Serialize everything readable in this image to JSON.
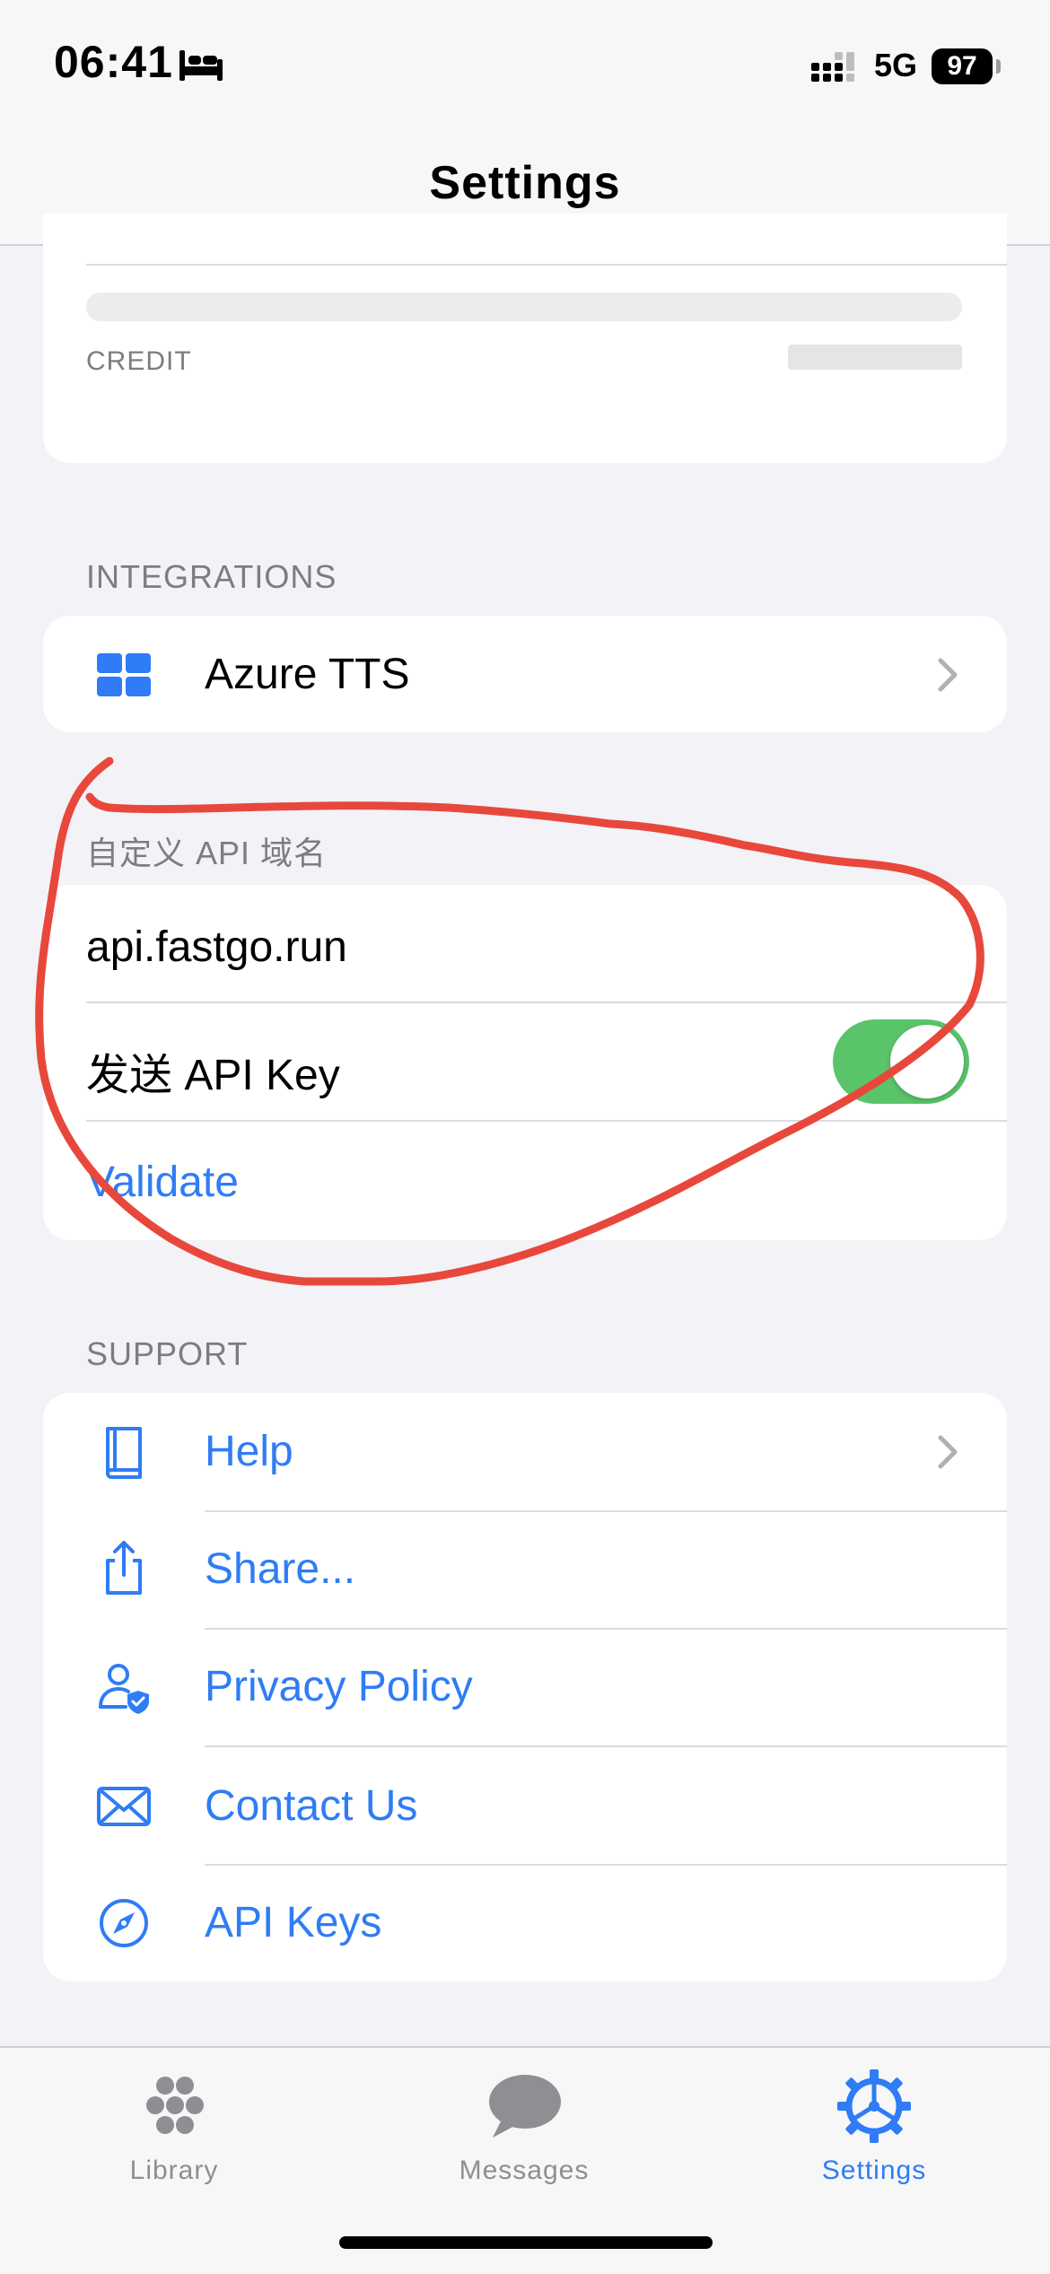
{
  "status_bar": {
    "time": "06:41",
    "network": "5G",
    "battery": "97"
  },
  "nav": {
    "title": "Settings"
  },
  "account": {
    "credit_label": "CREDIT"
  },
  "integrations": {
    "header": "INTEGRATIONS",
    "azure_label": "Azure TTS"
  },
  "custom_api": {
    "header": "自定义 API 域名",
    "domain_value": "api.fastgo.run",
    "send_key_label": "发送 API Key",
    "send_key_enabled": true,
    "validate_label": "Validate"
  },
  "support": {
    "header": "SUPPORT",
    "items": [
      {
        "label": "Help",
        "icon": "book-icon"
      },
      {
        "label": "Share...",
        "icon": "share-icon"
      },
      {
        "label": "Privacy Policy",
        "icon": "privacy-shield-person-icon"
      },
      {
        "label": "Contact Us",
        "icon": "envelope-icon"
      },
      {
        "label": "API Keys",
        "icon": "compass-icon"
      }
    ]
  },
  "tabs": [
    {
      "label": "Library",
      "icon": "grid-dots-icon",
      "active": false
    },
    {
      "label": "Messages",
      "icon": "speech-bubble-icon",
      "active": false
    },
    {
      "label": "Settings",
      "icon": "gear-icon",
      "active": true
    }
  ],
  "colors": {
    "accent": "#2f7cf6",
    "toggle_on": "#5ac46a",
    "annotation": "#e8483c",
    "background": "#f2f2f7"
  }
}
